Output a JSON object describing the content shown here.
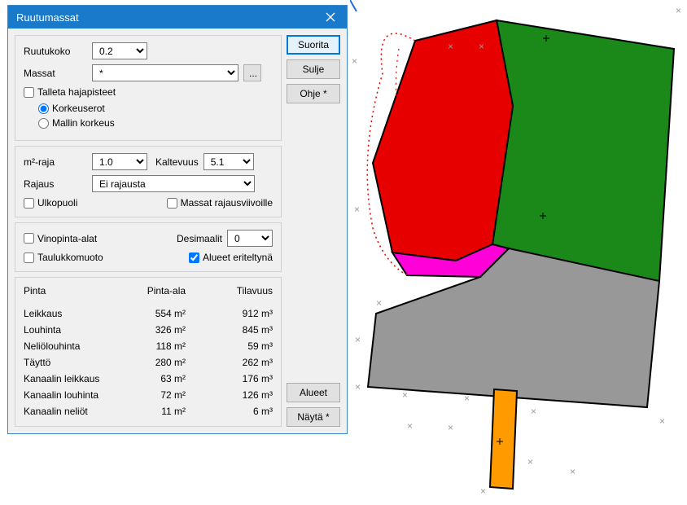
{
  "dialog": {
    "title": "Ruutumassat",
    "buttons": {
      "suorita": "Suorita",
      "sulje": "Sulje",
      "ohje": "Ohje *",
      "alueet": "Alueet",
      "nayta": "Näytä *",
      "dots": "..."
    },
    "group1": {
      "ruutukoko_label": "Ruutukoko",
      "ruutukoko_value": "0.2",
      "massat_label": "Massat",
      "massat_value": "*",
      "talleta": "Talleta hajapisteet",
      "korkeuserot": "Korkeuserot",
      "mallin_korkeus": "Mallin korkeus"
    },
    "group2": {
      "m2raja_label": "m²-raja",
      "m2raja_value": "1.0",
      "kaltevuus_label": "Kaltevuus",
      "kaltevuus_value": "5.1",
      "rajaus_label": "Rajaus",
      "rajaus_value": "Ei rajausta",
      "ulkopuoli": "Ulkopuoli",
      "massat_rajaus": "Massat rajausviivoille"
    },
    "group3": {
      "vinopinta": "Vinopinta-alat",
      "taulukko": "Taulukkomuoto",
      "desimaalit_label": "Desimaalit",
      "desimaalit_value": "0",
      "alueet_eriteltyna": "Alueet eriteltynä"
    },
    "table": {
      "headers": {
        "pinta": "Pinta",
        "pinta_ala": "Pinta-ala",
        "tilavuus": "Tilavuus"
      },
      "rows": [
        {
          "name": "Leikkaus",
          "area": "554 m²",
          "vol": "912 m³"
        },
        {
          "name": "Louhinta",
          "area": "326 m²",
          "vol": "845 m³"
        },
        {
          "name": "Neliölouhinta",
          "area": "118 m²",
          "vol": "59 m³"
        },
        {
          "name": "Täyttö",
          "area": "280 m²",
          "vol": "262 m³"
        },
        {
          "name": "Kanaalin leikkaus",
          "area": "63 m²",
          "vol": "176 m³"
        },
        {
          "name": "Kanaalin louhinta",
          "area": "72 m²",
          "vol": "126 m³"
        },
        {
          "name": "Kanaalin neliöt",
          "area": "11 m²",
          "vol": "6 m³"
        }
      ]
    }
  }
}
